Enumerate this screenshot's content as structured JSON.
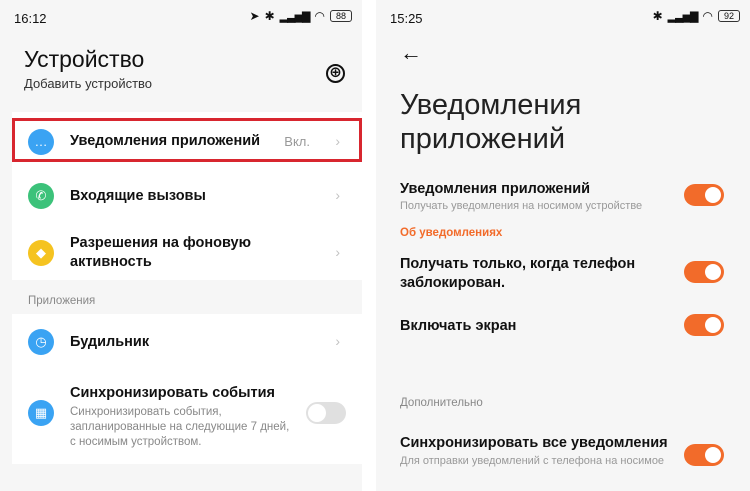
{
  "left": {
    "status": {
      "time": "16:12",
      "battery": "88"
    },
    "title": "Устройство",
    "subtitle": "Добавить устройство",
    "add_button": "⊕",
    "items": [
      {
        "label": "Уведомления приложений",
        "value": "Вкл.",
        "icon": "chat-bubble-icon",
        "color": "#3aa3f3"
      },
      {
        "label": "Входящие вызовы",
        "icon": "phone-icon",
        "color": "#3cc27a"
      },
      {
        "label": "Разрешения на фоновую активность",
        "icon": "shield-icon",
        "color": "#f5c320"
      }
    ],
    "section_apps": "Приложения",
    "apps": [
      {
        "label": "Будильник",
        "icon": "clock-icon",
        "color": "#3aa3f3"
      },
      {
        "label": "Синхронизировать события",
        "description": "Синхронизировать события, запланированные на следующие 7 дней, с носимым устройством.",
        "icon": "calendar-icon",
        "color": "#3aa3f3",
        "toggle_on": false
      }
    ]
  },
  "right": {
    "status": {
      "time": "15:25",
      "battery": "92"
    },
    "title": "Уведомления приложений",
    "settings": [
      {
        "label": "Уведомления приложений",
        "description": "Получать уведомления на носимом устройстве",
        "toggle_on": true
      },
      {
        "label": "Получать только, когда телефон заблокирован.",
        "toggle_on": true
      },
      {
        "label": "Включать экран",
        "toggle_on": true
      },
      {
        "label": "Синхронизировать все уведомления",
        "description": "Для отправки уведомлений с телефона на носимое",
        "toggle_on": true
      }
    ],
    "section_about": "Об уведомлениях",
    "section_more": "Дополнительно",
    "accent_color": "#f26b2a"
  }
}
